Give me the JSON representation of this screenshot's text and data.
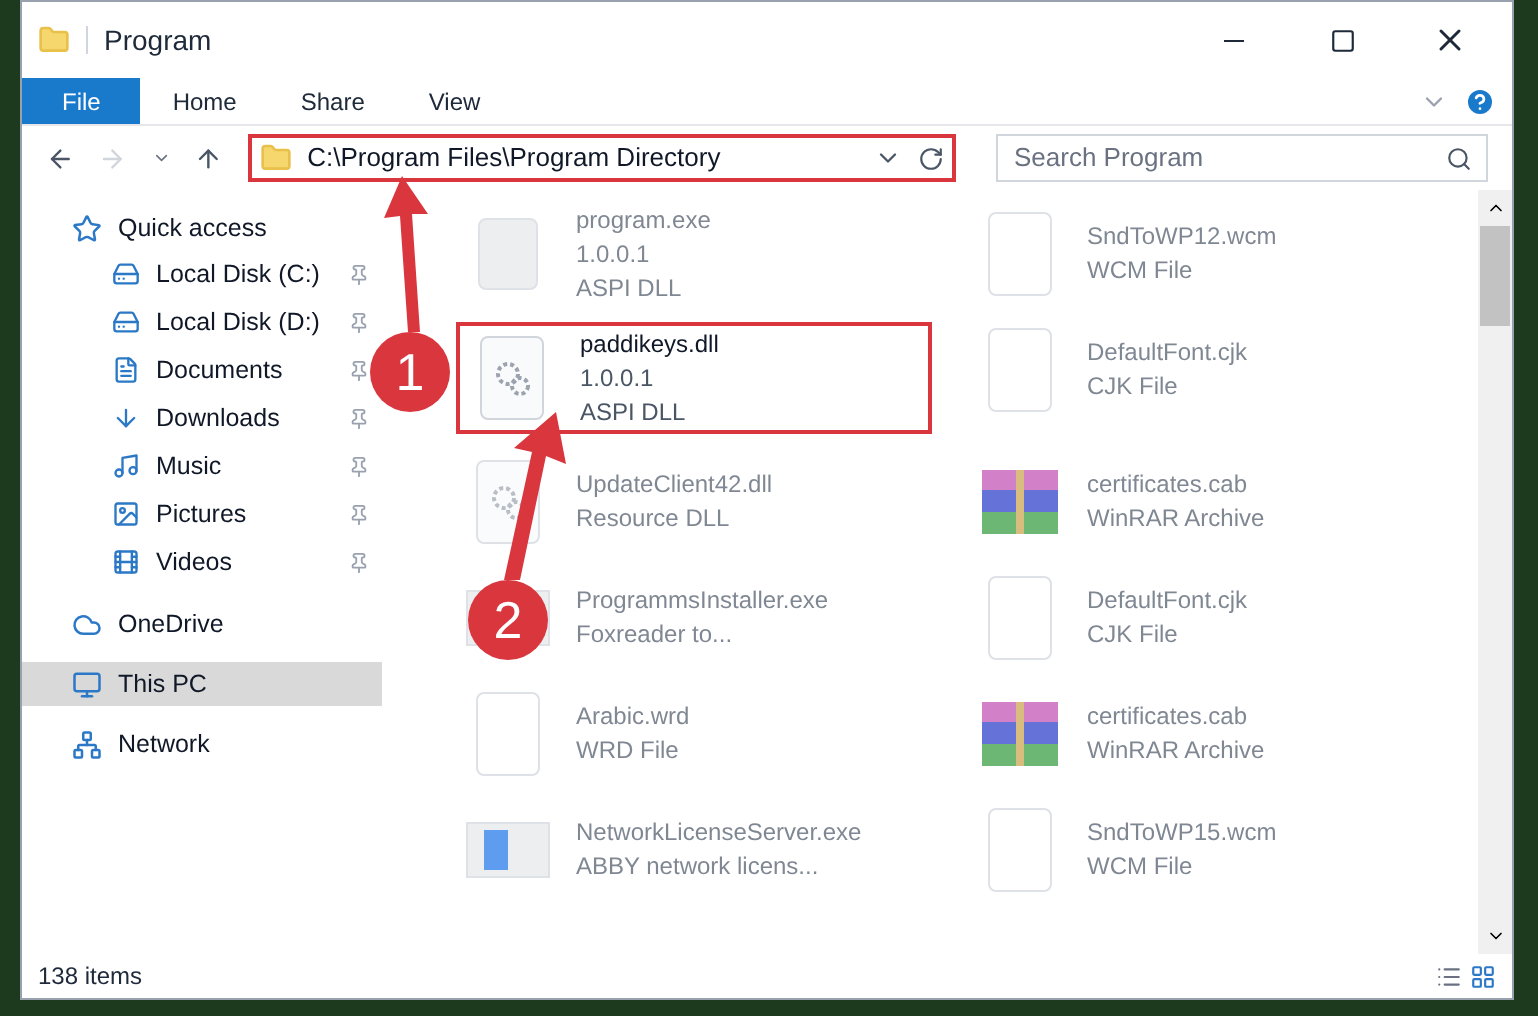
{
  "window": {
    "title": "Program"
  },
  "ribbon_tabs": [
    {
      "label": "File",
      "kind": "menu"
    },
    {
      "label": "Home",
      "kind": "tab"
    },
    {
      "label": "Share",
      "kind": "tab"
    },
    {
      "label": "View",
      "kind": "tab"
    }
  ],
  "address_bar": {
    "path": "C:\\Program Files\\Program Directory",
    "highlighted": true
  },
  "search": {
    "placeholder": "Search Program"
  },
  "sidebar": {
    "items": [
      {
        "label": "Quick access",
        "selected": false,
        "children": [
          {
            "label": "Local Disk (C:)",
            "pinned": true
          },
          {
            "label": "Local Disk (D:)",
            "pinned": true
          },
          {
            "label": "Documents",
            "pinned": true
          },
          {
            "label": "Downloads",
            "pinned": true
          },
          {
            "label": "Music",
            "pinned": true
          },
          {
            "label": "Pictures",
            "pinned": true
          },
          {
            "label": "Videos",
            "pinned": true
          }
        ]
      },
      {
        "label": "OneDrive",
        "selected": false
      },
      {
        "label": "This PC",
        "selected": true
      },
      {
        "label": "Network",
        "selected": false
      }
    ]
  },
  "files": [
    {
      "name": "program.exe",
      "details": [
        "1.0.0.1",
        "ASPI DLL"
      ],
      "kind": "program",
      "highlighted": false
    },
    {
      "name": "SndToWP12.wcm",
      "details": [
        "WCM File"
      ],
      "kind": "blank",
      "highlighted": false
    },
    {
      "name": "paddikeys.dll",
      "details": [
        "1.0.0.1",
        "ASPI DLL"
      ],
      "kind": "dll",
      "highlighted": true
    },
    {
      "name": "DefaultFont.cjk",
      "details": [
        "CJK File"
      ],
      "kind": "blank",
      "highlighted": false
    },
    {
      "name": "UpdateClient42.dll",
      "details": [
        "Resource DLL"
      ],
      "kind": "dll",
      "highlighted": false
    },
    {
      "name": "certificates.cab",
      "details": [
        "WinRAR Archive"
      ],
      "kind": "archive",
      "highlighted": false
    },
    {
      "name": "ProgrammsInstaller.exe",
      "details": [
        "Foxreader to..."
      ],
      "kind": "window",
      "highlighted": false
    },
    {
      "name": "DefaultFont.cjk",
      "details": [
        "CJK File"
      ],
      "kind": "blank",
      "highlighted": false
    },
    {
      "name": "Arabic.wrd",
      "details": [
        "WRD File"
      ],
      "kind": "blank",
      "highlighted": false
    },
    {
      "name": "certificates.cab",
      "details": [
        "WinRAR Archive"
      ],
      "kind": "archive",
      "highlighted": false
    },
    {
      "name": "NetworkLicenseServer.exe",
      "details": [
        "ABBY network licens..."
      ],
      "kind": "window",
      "highlighted": false
    },
    {
      "name": "SndToWP15.wcm",
      "details": [
        "WCM File"
      ],
      "kind": "blank",
      "highlighted": false
    }
  ],
  "annotations": [
    {
      "label": "1"
    },
    {
      "label": "2"
    }
  ],
  "status_bar": {
    "text": "138 items"
  }
}
